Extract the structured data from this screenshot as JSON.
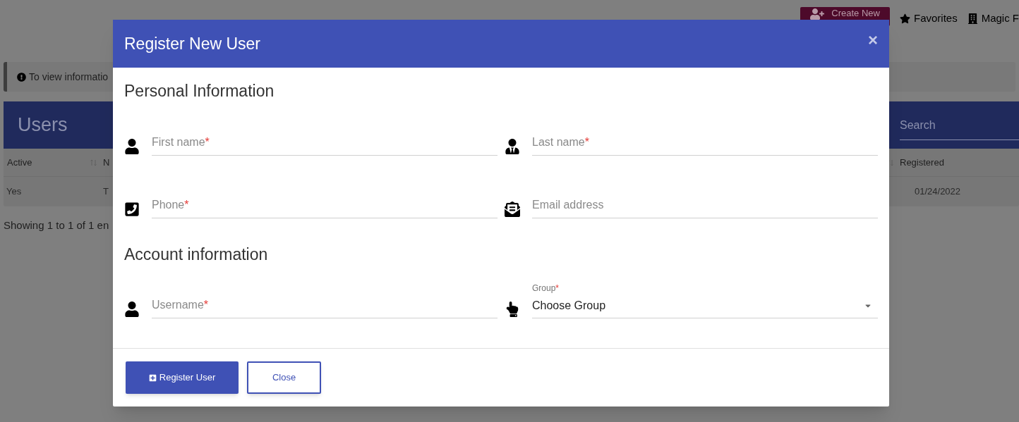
{
  "background": {
    "create_button": "Create New",
    "links": [
      "Favorites",
      "Magic F"
    ],
    "alert": "To view informatio",
    "panel": {
      "title": "Users",
      "search": {
        "placeholder": "Search"
      }
    },
    "table": {
      "columns": [
        "Active",
        "N",
        "Registered"
      ],
      "rows": [
        [
          "Yes",
          "T",
          "01/24/2022"
        ]
      ]
    },
    "footer": "Showing 1 to 1 of 1 en"
  },
  "dialog": {
    "title": "Register New User",
    "close": "×",
    "sections": [
      {
        "title": "Personal Information",
        "fields": [
          {
            "kind": "text",
            "label": "First name",
            "required_mark": "*"
          },
          {
            "kind": "text",
            "label": "Last name",
            "required_mark": "*"
          },
          {
            "kind": "text",
            "label": "Phone",
            "required_mark": "*"
          },
          {
            "kind": "text",
            "label": "Email address"
          }
        ]
      },
      {
        "title": "Account information",
        "fields": [
          {
            "kind": "text",
            "label": "Username",
            "required_mark": "*"
          },
          {
            "kind": "select",
            "label": "Group",
            "required_mark": "*",
            "value": "Choose Group"
          }
        ]
      }
    ],
    "buttons": [
      {
        "kind": "primary",
        "label": "Register User"
      },
      {
        "kind": "secondary",
        "label": "Close"
      }
    ]
  }
}
